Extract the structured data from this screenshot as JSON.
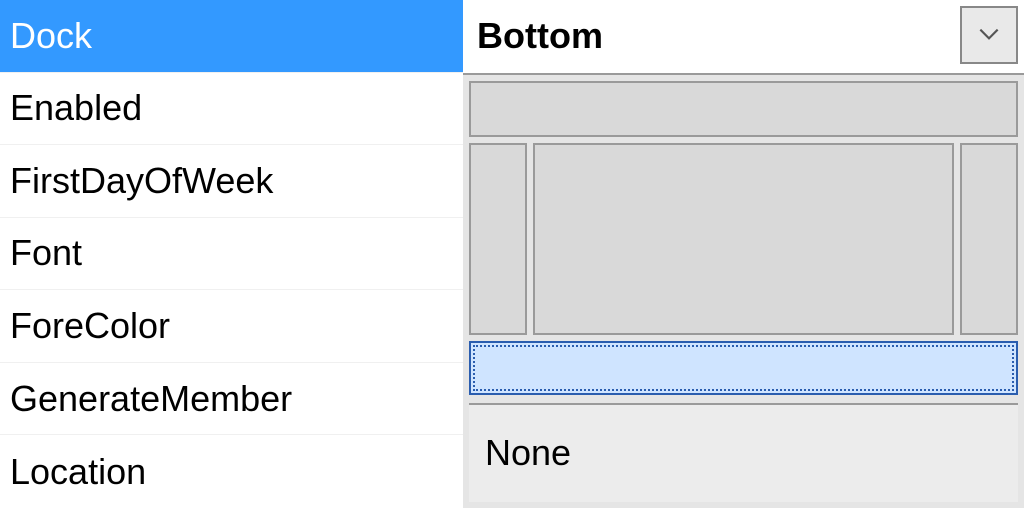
{
  "properties": [
    {
      "name": "Dock",
      "selected": true
    },
    {
      "name": "Enabled",
      "selected": false
    },
    {
      "name": "FirstDayOfWeek",
      "selected": false
    },
    {
      "name": "Font",
      "selected": false
    },
    {
      "name": "ForeColor",
      "selected": false
    },
    {
      "name": "GenerateMember",
      "selected": false
    },
    {
      "name": "Location",
      "selected": false
    }
  ],
  "value": {
    "selected_label": "Bottom",
    "none_label": "None"
  },
  "colors": {
    "selection_bg": "#3399ff",
    "panel_bg": "#e5e5e5",
    "cell_bg": "#d9d9d9",
    "cell_border": "#9a9a9a",
    "active_border": "#2a5daf",
    "active_bg": "#cfe4ff"
  }
}
